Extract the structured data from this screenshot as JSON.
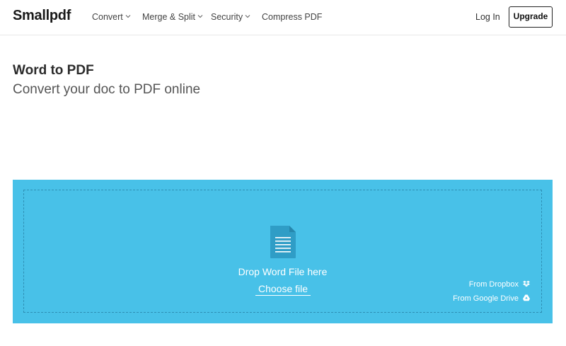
{
  "brand": {
    "logo_text": "Smallpdf"
  },
  "nav": {
    "items": [
      {
        "label": "Convert",
        "has_dropdown": true
      },
      {
        "label": "Merge & Split",
        "has_dropdown": true
      },
      {
        "label": "Security",
        "has_dropdown": true
      },
      {
        "label": "Compress PDF",
        "has_dropdown": false
      }
    ],
    "login_label": "Log In",
    "upgrade_label": "Upgrade"
  },
  "page": {
    "title": "Word to PDF",
    "subtitle": "Convert your doc to PDF online"
  },
  "upload": {
    "drop_text": "Drop Word File here",
    "choose_file_label": "Choose file",
    "dropbox_label": "From Dropbox",
    "dropbox_icon": "dropbox-icon",
    "gdrive_label": "From Google Drive",
    "gdrive_icon": "google-drive-icon"
  },
  "colors": {
    "panel_background": "#48c1e8",
    "file_icon": "#2f9dc6",
    "text_dark": "#2b2b2b"
  }
}
